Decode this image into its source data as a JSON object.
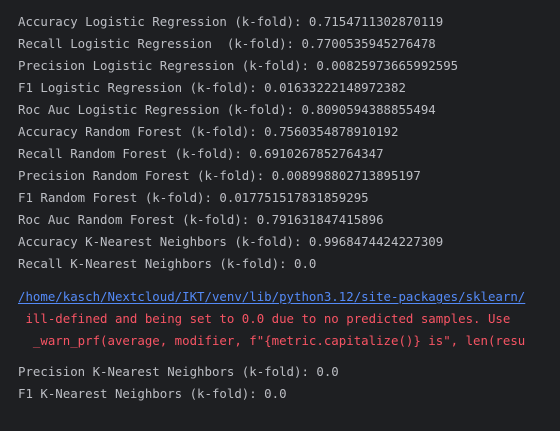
{
  "output": {
    "results_before_warning": [
      "Accuracy Logistic Regression (k-fold): 0.7154711302870119",
      "Recall Logistic Regression  (k-fold): 0.7700535945276478",
      "Precision Logistic Regression (k-fold): 0.008259736659925​95",
      "F1 Logistic Regression (k-fold): 0.01633222148972382",
      "Roc Auc Logistic Regression (k-fold): 0.8090594388855494",
      "Accuracy Random Forest (k-fold): 0.7560354878910192",
      "Recall Random Forest (k-fold): 0.6910267852764347",
      "Precision Random Forest (k-fold): 0.008998802713895197",
      "F1 Random Forest (k-fold): 0.017751517831859295",
      "Roc Auc Random Forest (k-fold): 0.791631847415896",
      "Accuracy K-Nearest Neighbors (k-fold): 0.9968474424227309",
      "Recall K-Nearest Neighbors (k-fold): 0.0"
    ],
    "warning": {
      "path_link": "/home/kasch/Nextcloud/IKT/venv/lib/python3.12/site-packages/sklearn/",
      "message": " ill-defined and being set to 0.0 due to no predicted samples. Use",
      "source_line": "  _warn_prf(average, modifier, f\"{metric.capitalize()} is\", len(resu"
    },
    "results_after_warning": [
      "Precision K-Nearest Neighbors (k-fold): 0.0",
      "F1 K-Nearest Neighbors (k-fold): 0.0"
    ]
  },
  "colors": {
    "background": "#1e1f22",
    "text": "#bcbec4",
    "link": "#548af7",
    "warning": "#f75464"
  }
}
